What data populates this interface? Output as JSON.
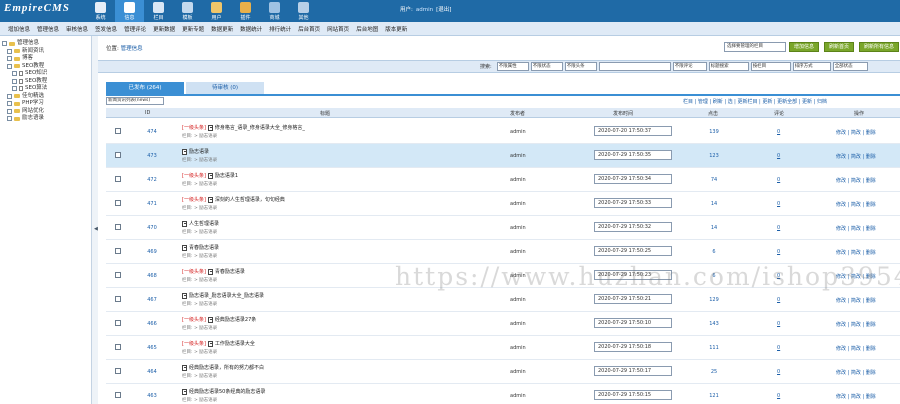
{
  "header": {
    "logo": "EmpireCMS",
    "nav": [
      {
        "label": "系统",
        "icon": "system-icon",
        "color": "#e6eef7",
        "active": false
      },
      {
        "label": "信息",
        "icon": "info-icon",
        "color": "#ffffff",
        "active": true
      },
      {
        "label": "栏目",
        "icon": "column-icon",
        "color": "#d9e7f5",
        "active": false
      },
      {
        "label": "模板",
        "icon": "template-icon",
        "color": "#c3d9ee",
        "active": false
      },
      {
        "label": "用户",
        "icon": "user-icon",
        "color": "#f0c66a",
        "active": false
      },
      {
        "label": "插件",
        "icon": "plugin-icon",
        "color": "#e8b04a",
        "active": false
      },
      {
        "label": "商城",
        "icon": "shop-icon",
        "color": "#9fc2e3",
        "active": false
      },
      {
        "label": "其他",
        "icon": "other-icon",
        "color": "#b8d0e8",
        "active": false
      }
    ],
    "user_prefix": "用户:",
    "username": "admin",
    "logout": "[退出]"
  },
  "menubar": {
    "items": [
      "增加信息",
      "管理信息",
      "审核信息",
      "签发信息",
      "管理评论",
      "更新数据",
      "更新专题",
      "数据更新",
      "数据统计",
      "排行统计",
      "后台首页",
      "网站首页",
      "后台地图",
      "版本更新"
    ]
  },
  "sidebar": {
    "items": [
      {
        "label": "管理信息",
        "level": 0,
        "kind": "folder"
      },
      {
        "label": "新闻资讯",
        "level": 1,
        "kind": "folder"
      },
      {
        "label": "博客",
        "level": 1,
        "kind": "folder"
      },
      {
        "label": "SEO教程",
        "level": 1,
        "kind": "folder"
      },
      {
        "label": "SEO知识",
        "level": 2,
        "kind": "doc"
      },
      {
        "label": "SEO教程",
        "level": 2,
        "kind": "doc"
      },
      {
        "label": "SEO算法",
        "level": 2,
        "kind": "doc"
      },
      {
        "label": "佳句精选",
        "level": 1,
        "kind": "folder"
      },
      {
        "label": "PHP学习",
        "level": 1,
        "kind": "folder"
      },
      {
        "label": "网站优化",
        "level": 1,
        "kind": "folder"
      },
      {
        "label": "励志语录",
        "level": 1,
        "kind": "folder"
      }
    ]
  },
  "main": {
    "breadcrumb_prefix": "位置:",
    "breadcrumb_link": "管理信息",
    "column_select": "选择要管理的栏目",
    "top_buttons": [
      "增加信息",
      "刷新首页",
      "刷新所有信息"
    ],
    "search_label": "搜索:",
    "search_selects": [
      "不限属性",
      "不限状态",
      "不限头条",
      "不限评论",
      "标题搜索",
      "按栏目",
      "排序方式",
      "全部状态"
    ],
    "tabs": [
      "已发布 (264)",
      "待审核 (0)"
    ],
    "sort_select": "新闻资讯列表(news)",
    "quicklinks": "栏目 | 管理 | 刷新 | 选 | 更新栏目 | 更新 | 更新全部 | 更新 | 归档",
    "columns": {
      "id": "ID",
      "title": "标题",
      "publisher": "发布者",
      "time": "发布时间",
      "hits": "点击",
      "comments": "评论",
      "ops": "操作"
    },
    "row_subtitle": "栏目: > 励志语录",
    "ops_label": "修改 | 简改 | 删除",
    "tag_label": "[一级头条]",
    "rows": [
      {
        "id": "474",
        "tag": true,
        "title": "修身格言_语录_修身语录大全_修身格言_",
        "publisher": "admin",
        "time": "2020-07-20 17:50:37",
        "hits": "139",
        "comments": "0",
        "highlight": false
      },
      {
        "id": "473",
        "tag": false,
        "title": "励志语录",
        "publisher": "admin",
        "time": "2020-07-29 17:50:35",
        "hits": "123",
        "comments": "0",
        "highlight": true
      },
      {
        "id": "472",
        "tag": true,
        "title": "励志语录1",
        "publisher": "admin",
        "time": "2020-07-29 17:50:34",
        "hits": "74",
        "comments": "0",
        "highlight": false
      },
      {
        "id": "471",
        "tag": true,
        "title": "深刻的人生哲理语录，句句经典",
        "publisher": "admin",
        "time": "2020-07-29 17:50:33",
        "hits": "14",
        "comments": "0",
        "highlight": false
      },
      {
        "id": "470",
        "tag": false,
        "title": "人生哲理语录",
        "publisher": "admin",
        "time": "2020-07-29 17:50:32",
        "hits": "14",
        "comments": "0",
        "highlight": false
      },
      {
        "id": "469",
        "tag": false,
        "title": "青春励志语录",
        "publisher": "admin",
        "time": "2020-07-29 17:50:25",
        "hits": "6",
        "comments": "0",
        "highlight": false
      },
      {
        "id": "468",
        "tag": true,
        "title": "青春励志语录",
        "publisher": "admin",
        "time": "2020-07-29 17:50:23",
        "hits": "6",
        "comments": "0",
        "highlight": false
      },
      {
        "id": "467",
        "tag": false,
        "title": "励志语录_励志语录大全_励志语录",
        "publisher": "admin",
        "time": "2020-07-29 17:50:21",
        "hits": "129",
        "comments": "0",
        "highlight": false
      },
      {
        "id": "466",
        "tag": true,
        "title": "经典励志语录27条",
        "publisher": "admin",
        "time": "2020-07-29 17:50:10",
        "hits": "143",
        "comments": "0",
        "highlight": false
      },
      {
        "id": "465",
        "tag": true,
        "title": "工作励志语录大全",
        "publisher": "admin",
        "time": "2020-07-29 17:50:18",
        "hits": "111",
        "comments": "0",
        "highlight": false
      },
      {
        "id": "464",
        "tag": false,
        "title": "经典励志语录，所有的努力都不白",
        "publisher": "admin",
        "time": "2020-07-29 17:50:17",
        "hits": "25",
        "comments": "0",
        "highlight": false
      },
      {
        "id": "463",
        "tag": false,
        "title": "经典励志语录50条经典的励志语录",
        "publisher": "admin",
        "time": "2020-07-29 17:50:15",
        "hits": "121",
        "comments": "0",
        "highlight": false
      }
    ]
  },
  "watermark": "https://www.huzhan.com/ishop39549"
}
